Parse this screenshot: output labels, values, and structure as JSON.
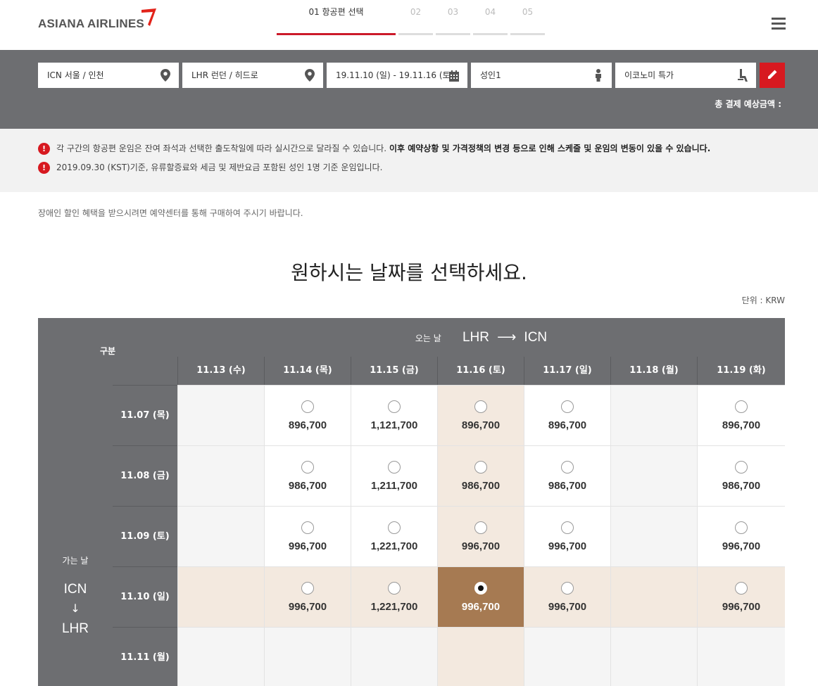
{
  "header": {
    "logo_text": "ASIANA AIRLINES",
    "steps": [
      {
        "label": "01 항공편 선택",
        "active": true
      },
      {
        "label": "02",
        "active": false
      },
      {
        "label": "03",
        "active": false
      },
      {
        "label": "04",
        "active": false
      },
      {
        "label": "05",
        "active": false
      }
    ],
    "menu_icon": "hamburger-icon"
  },
  "search": {
    "origin": "ICN 서울 / 인천",
    "destination": "LHR 런던 / 히드로",
    "dates": "19.11.10 (일) - 19.11.16 (토)",
    "passengers": "성인1",
    "cabin": "이코노미 특가",
    "total_label": "총 결제 예상금액 :"
  },
  "notices": {
    "line1_text": "각 구간의 항공편 운임은 잔여 좌석과 선택한 출도착일에 따라 실시간으로 달라질 수 있습니다. ",
    "line1_bold": "이후 예약상황 및 가격정책의 변경 등으로 인해 스케줄 및 운임의 변동이 있을 수 있습니다.",
    "line2_text": "2019.09.30 (KST)기준, 유류할증료와 세금 및 제반요금 포함된 성인 1명 기준 운임입니다.",
    "disabled_note": "장애인 할인 혜택을 받으시려면 예약센터를 통해 구매하여 주시기 바랍니다."
  },
  "main": {
    "heading": "원하시는 날짜를 선택하세요.",
    "unit": "단위 : KRW"
  },
  "fare_table": {
    "corner_label": "구분",
    "return_label": "오는 날",
    "return_from": "LHR",
    "return_to": "ICN",
    "depart_label": "가는 날",
    "depart_from": "ICN",
    "depart_to": "LHR",
    "return_dates": [
      "11.13 (수)",
      "11.14 (목)",
      "11.15 (금)",
      "11.16 (토)",
      "11.17 (일)",
      "11.18 (월)",
      "11.19 (화)"
    ],
    "depart_dates": [
      "11.07 (목)",
      "11.08 (금)",
      "11.09 (토)",
      "11.10 (일)",
      "11.11 (월)"
    ],
    "selected": {
      "row": 3,
      "col": 3
    },
    "fares": [
      [
        null,
        "896,700",
        "1,121,700",
        "896,700",
        "896,700",
        null,
        "896,700"
      ],
      [
        null,
        "986,700",
        "1,211,700",
        "986,700",
        "986,700",
        null,
        "986,700"
      ],
      [
        null,
        "996,700",
        "1,221,700",
        "996,700",
        "996,700",
        null,
        "996,700"
      ],
      [
        null,
        "996,700",
        "1,221,700",
        "996,700",
        "996,700",
        null,
        "996,700"
      ],
      [
        null,
        null,
        null,
        null,
        null,
        null,
        null
      ]
    ]
  },
  "colors": {
    "brand_red": "#d71920",
    "header_gray": "#6d6e71",
    "highlight": "#f3e9df",
    "selected": "#a67a52"
  }
}
